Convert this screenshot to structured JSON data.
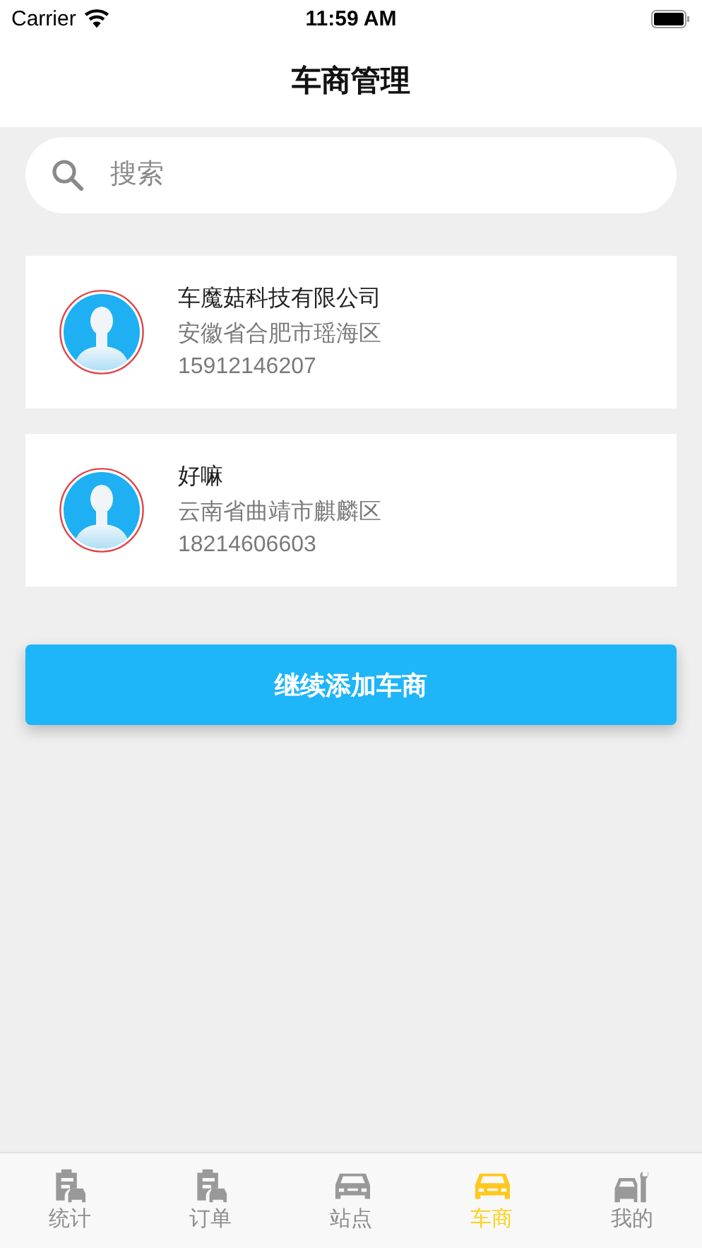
{
  "status_bar": {
    "carrier": "Carrier",
    "time": "11:59 AM"
  },
  "nav_bar": {
    "title": "车商管理"
  },
  "search": {
    "placeholder": "搜索"
  },
  "dealers": [
    {
      "name": "车魔菇科技有限公司",
      "address": "安徽省合肥市瑶海区",
      "phone": "15912146207"
    },
    {
      "name": "好嘛",
      "address": "云南省曲靖市麒麟区",
      "phone": "18214606603"
    }
  ],
  "add_button": "继续添加车商",
  "tab_bar": [
    {
      "label": "统计",
      "kind": "clipboard-car",
      "selected": false
    },
    {
      "label": "订单",
      "kind": "clipboard-car",
      "selected": false
    },
    {
      "label": "站点",
      "kind": "car",
      "selected": false
    },
    {
      "label": "车商",
      "kind": "car",
      "selected": true
    },
    {
      "label": "我的",
      "kind": "car-wrench",
      "selected": false
    }
  ]
}
